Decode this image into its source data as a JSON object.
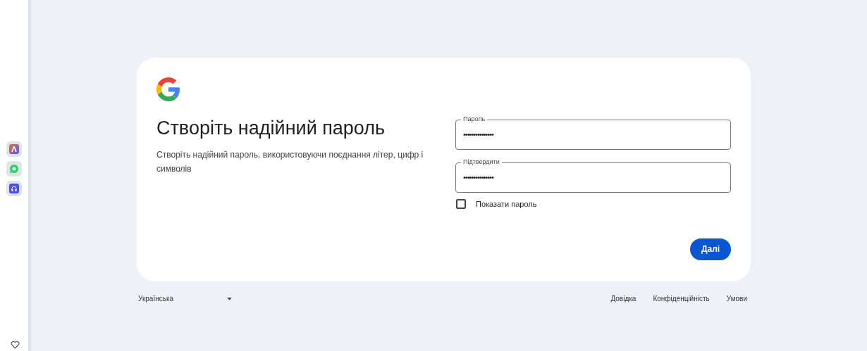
{
  "sidebar": {
    "apps": [
      {
        "kind": "launcher"
      },
      {
        "kind": "chat"
      },
      {
        "kind": "support"
      }
    ]
  },
  "card": {
    "title": "Створіть надійний пароль",
    "subtitle": "Створіть надійний пароль, використовуючи поєднання літер, цифр і символів",
    "fields": [
      {
        "label": "Пароль",
        "value": "•••••••••••••••"
      },
      {
        "label": "Підтвердити",
        "value": "•••••••••••••••"
      }
    ],
    "show_password": {
      "label": "Показати пароль",
      "checked": false
    },
    "next_button": "Далі"
  },
  "footer": {
    "language": "Українська",
    "links": [
      "Довідка",
      "Конфіденційність",
      "Умови"
    ]
  }
}
